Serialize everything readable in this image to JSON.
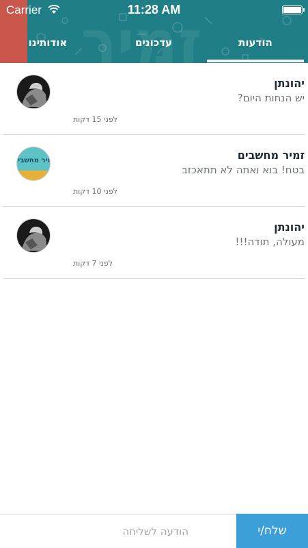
{
  "status_bar": {
    "carrier": "Carrier",
    "time": "11:28 AM"
  },
  "header": {
    "logo_text": "זמיר",
    "colors": {
      "background": "#1f7e86",
      "accent": "#c9574c"
    },
    "tabs": [
      {
        "label": "אודותינו"
      },
      {
        "label": "עדכונים"
      },
      {
        "label": "הודעות",
        "active": true
      }
    ]
  },
  "messages": [
    {
      "sender": "יהונתן",
      "text": "יש הנחות היום?",
      "time": "לפני 15 דקות",
      "avatar": "dark"
    },
    {
      "sender": "זמיר מחשבים",
      "text": "בטח! בוא ואתה לא תתאכזב",
      "time": "לפני 10 דקות",
      "avatar": "teal",
      "avatar_text": "זמיר מחשבים"
    },
    {
      "sender": "יהונתן",
      "text": "מעולה, תודה!!!",
      "time": "לפני 7 דקות",
      "avatar": "dark"
    }
  ],
  "composer": {
    "placeholder": "הודעה לשליחה",
    "send_label": "שלח/י",
    "send_color": "#3d9fd8"
  }
}
